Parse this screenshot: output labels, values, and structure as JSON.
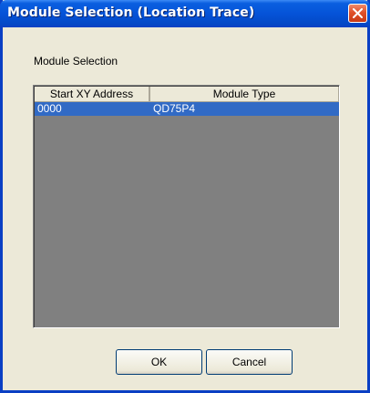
{
  "window": {
    "title": "Module Selection (Location Trace)"
  },
  "group": {
    "label": "Module Selection"
  },
  "list": {
    "columns": [
      "Start XY Address",
      "Module Type"
    ],
    "rows": [
      {
        "address": "0000",
        "module_type": "QD75P4",
        "selected": true
      }
    ]
  },
  "buttons": {
    "ok": "OK",
    "cancel": "Cancel"
  },
  "colors": {
    "title_bar": "#0553d8",
    "selection": "#316ac5",
    "list_background": "#808080",
    "dialog_background": "#ece9d8",
    "close_button": "#e0512a"
  },
  "icons": {
    "close": "close-icon"
  }
}
